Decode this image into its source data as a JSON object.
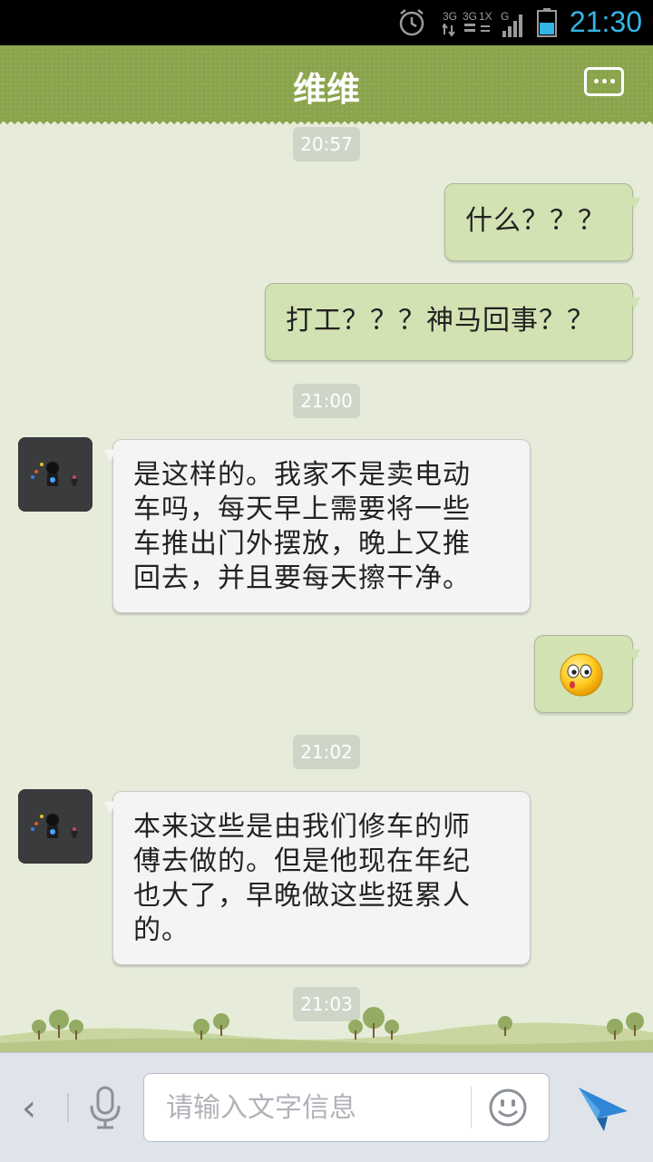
{
  "status_bar": {
    "time": "21:30",
    "icons": [
      "alarm-icon",
      "network-3g-icon",
      "signal-icon",
      "battery-icon"
    ],
    "network_labels": [
      "3G",
      "3G",
      "1X",
      "G"
    ]
  },
  "header": {
    "title": "维维",
    "menu_icon": "more-options-icon",
    "color": "#8aa44b"
  },
  "chat": {
    "timestamps": [
      "20:57",
      "21:00",
      "21:02",
      "21:03"
    ],
    "outgoing": [
      "什么？？？",
      "打工？？？神马回事？？"
    ],
    "incoming": [
      {
        "lines": [
          "是这样的。我家不是卖电动",
          "车吗，每天早上需要将一些",
          "车推出门外摆放，晚上又推",
          "回去，并且要每天擦干净。"
        ]
      },
      {
        "lines": [
          "本来这些是由我们修车的师",
          "傅去做的。但是他现在年纪",
          "也大了，早晚做这些挺累人",
          "的。"
        ]
      }
    ],
    "emoji_message": "surprised-emoji-icon"
  },
  "input_bar": {
    "back_icon": "chevron-left-icon",
    "voice_icon": "microphone-icon",
    "placeholder": "请输入文字信息",
    "emoji_icon": "smiley-icon",
    "send_icon": "send-icon"
  },
  "colors": {
    "background": "#e6ecd9",
    "outgoing_bubble": "#d2e2b2",
    "incoming_bubble": "#f4f4f4",
    "timestamp_bg": "#cfd5c7",
    "send_icon": "#2f86d4"
  }
}
